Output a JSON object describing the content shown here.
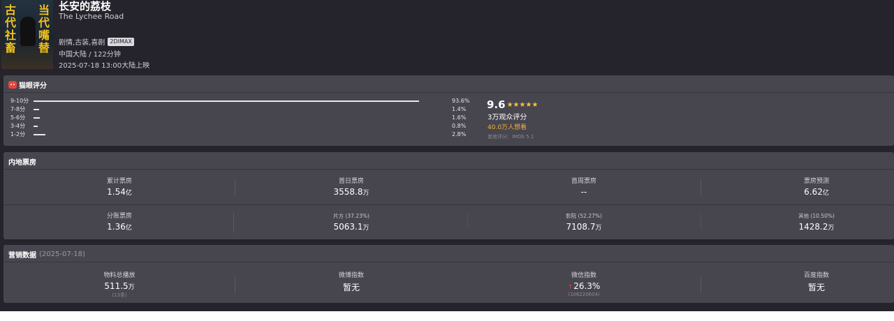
{
  "movie": {
    "poster_left_text": "古代社畜",
    "poster_right_text": "当代嘴替",
    "title": "长安的荔枝",
    "subtitle": "The Lychee Road",
    "genres": "剧情,古装,喜剧",
    "format": "2DIMAX",
    "region_duration": "中国大陆 / 122分钟",
    "release": "2025-07-18 13:00大陆上映"
  },
  "rating": {
    "heading": "猫眼评分",
    "distribution": [
      {
        "label": "9-10分",
        "pct_text": "93.6%",
        "pct": 93.6
      },
      {
        "label": "7-8分",
        "pct_text": "1.4%",
        "pct": 1.4
      },
      {
        "label": "5-6分",
        "pct_text": "1.6%",
        "pct": 1.6
      },
      {
        "label": "3-4分",
        "pct_text": "0.8%",
        "pct": 0.8
      },
      {
        "label": "1-2分",
        "pct_text": "2.8%",
        "pct": 2.8
      }
    ],
    "score": "9.6",
    "stars": "★★★★★",
    "score_count": "3万观众评分",
    "want": "40.0万人想看",
    "other_score": "其他评分：IMDb 5.1"
  },
  "box_office": {
    "heading": "内地票房",
    "row1": [
      {
        "label": "累计票房",
        "value": "1.54",
        "unit": "亿"
      },
      {
        "label": "首日票房",
        "value": "3558.8",
        "unit": "万"
      },
      {
        "label": "首周票房",
        "value": "--",
        "unit": ""
      },
      {
        "label": "票房预测",
        "value": "6.62",
        "unit": "亿"
      }
    ],
    "row2": [
      {
        "label": "分账票房",
        "value": "1.36",
        "unit": "亿"
      },
      {
        "label": "片方 (37.23%)",
        "value": "5063.1",
        "unit": "万"
      },
      {
        "label": "影院 (52.27%)",
        "value": "7108.7",
        "unit": "万"
      },
      {
        "label": "其他 (10.50%)",
        "value": "1428.2",
        "unit": "万"
      }
    ]
  },
  "marketing": {
    "heading": "营销数据",
    "date": "(2025-07-18)",
    "stats": [
      {
        "label": "物料总播放",
        "value": "511.5",
        "unit": "万",
        "note": "(13条)"
      },
      {
        "label": "微博指数",
        "value": "暂无",
        "unit": "",
        "note": ""
      },
      {
        "label": "微信指数",
        "arrow": "↑",
        "value": "26.3%",
        "unit": "",
        "note": "(106220604)"
      },
      {
        "label": "百度指数",
        "value": "暂无",
        "unit": "",
        "note": ""
      }
    ]
  },
  "colors": {
    "background": "#25232b",
    "panel": "#47454e",
    "star": "#f7c03f",
    "want": "#f0b23a",
    "accent_red": "#e8453c"
  }
}
